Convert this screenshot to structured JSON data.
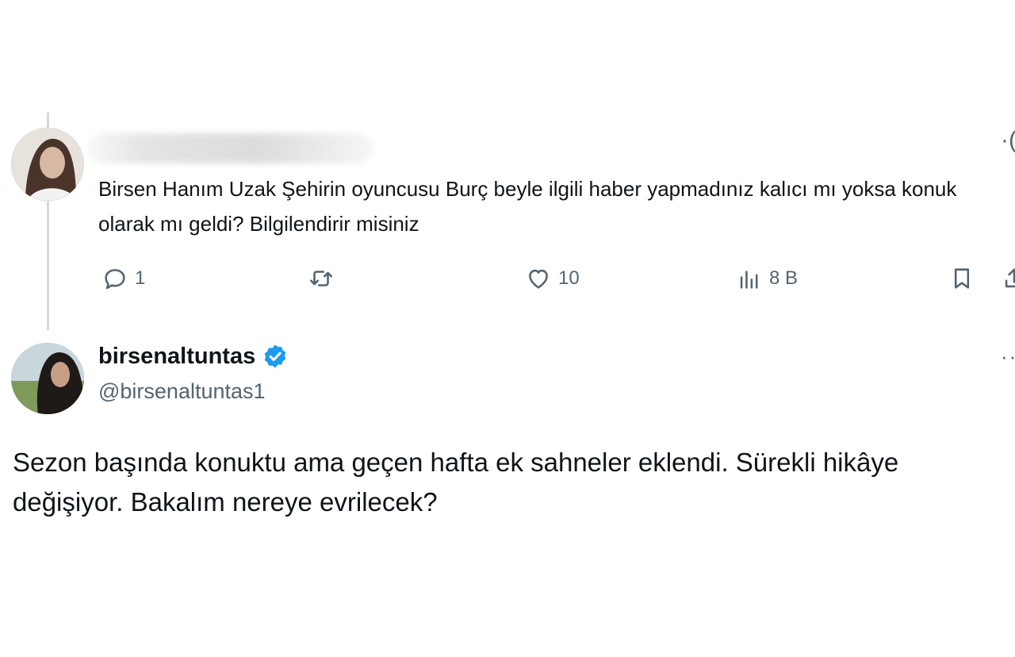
{
  "reply_tweet": {
    "text": "Birsen Hanım Uzak Şehirin oyuncusu Burç beyle ilgili haber yapmadınız kalıcı mı yoksa konuk olarak mı geldi? Bilgilendirir misiniz",
    "more_glyph": "·(",
    "actions": {
      "reply_count": "1",
      "like_count": "10",
      "views_count": "8 B"
    }
  },
  "author_tweet": {
    "display_name": "birsenaltuntas",
    "handle": "@birsenaltuntas1",
    "more_glyph": "··",
    "text": "Sezon başında konuktu ama geçen hafta ek sahneler eklendi. Sürekli hikâye değişiyor. Bakalım nereye evrilecek?"
  },
  "colors": {
    "text_primary": "#0f1419",
    "text_secondary": "#536471",
    "verified_blue": "#1d9bf0",
    "thread_line": "#cfd9de"
  },
  "icons": [
    "reply-icon",
    "retweet-icon",
    "like-icon",
    "views-icon",
    "bookmark-icon",
    "share-icon",
    "verified-badge-icon",
    "more-options-icon"
  ]
}
